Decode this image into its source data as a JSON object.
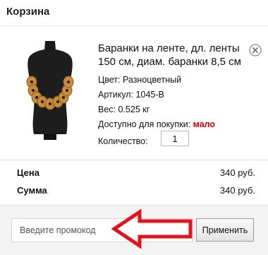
{
  "cart": {
    "title": "Корзина"
  },
  "item": {
    "name": "Баранки на ленте, дл. ленты 150 см, диам. баранки 8,5 см",
    "image_icon": "bagel-necklace-on-mannequin",
    "remove_icon": "close-circle-icon",
    "properties": {
      "color": "Цвет: Разноцветный",
      "sku": "Артикул: 1045-В",
      "weight": "Вес: 0.525 кг",
      "availability_label": "Доступно для покупки:",
      "availability_value": "мало"
    },
    "quantity_label": "Количество:",
    "quantity_value": "1"
  },
  "totals": {
    "price_label": "Цена",
    "price_value": "340 руб.",
    "sum_label": "Сумма",
    "sum_value": "340 руб."
  },
  "promo": {
    "placeholder": "Введите промокод",
    "apply_label": "Применить"
  },
  "colors": {
    "annotation_arrow": "#e0141c",
    "availability": "#d40000"
  }
}
